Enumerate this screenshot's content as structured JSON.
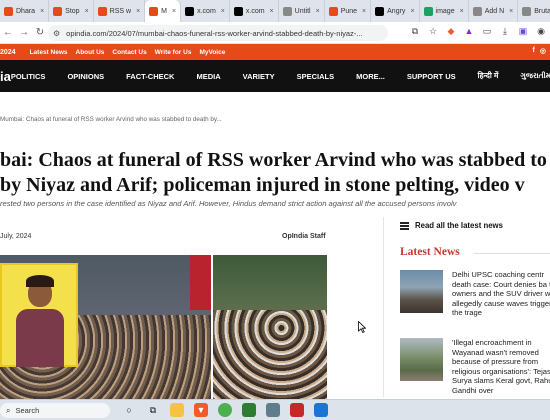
{
  "browser": {
    "tabs": [
      {
        "label": "Dhara",
        "color": "#e64a19",
        "active": false
      },
      {
        "label": "Stop",
        "color": "#e64a19",
        "active": false
      },
      {
        "label": "RSS w",
        "color": "#e64a19",
        "active": false
      },
      {
        "label": "M",
        "color": "#e64a19",
        "active": true
      },
      {
        "label": "x.com",
        "color": "#000000",
        "active": false
      },
      {
        "label": "x.com",
        "color": "#000000",
        "active": false
      },
      {
        "label": "Untitl",
        "color": "#888888",
        "active": false
      },
      {
        "label": "Pune",
        "color": "#e64a19",
        "active": false
      },
      {
        "label": "Angry",
        "color": "#000000",
        "active": false
      },
      {
        "label": "image",
        "color": "#1aa260",
        "active": false
      },
      {
        "label": "Add N",
        "color": "#888888",
        "active": false
      },
      {
        "label": "Brutal",
        "color": "#888888",
        "active": false
      }
    ],
    "close_glyph": "×",
    "new_tab": "+",
    "url": "opindia.com/2024/07/mumbai-chaos-funeral-rss-worker-arvind-stabbed-death-by-niyaz-..."
  },
  "site": {
    "topbar_year": "2024",
    "topbar_links": [
      "Latest News",
      "About Us",
      "Contact Us",
      "Write for Us",
      "MyVoice"
    ],
    "logo_fragment": "ia",
    "menu": [
      "POLITICS",
      "OPINIONS",
      "FACT-CHECK",
      "MEDIA",
      "VARIETY",
      "SPECIALS",
      "MORE...",
      "SUPPORT US",
      "हिन्दी में",
      "ગુજરાતીમાં"
    ],
    "accent": "#e64a19"
  },
  "article": {
    "breadcrumb": "Mumbai: Chaos at funeral of RSS worker Arvind who was stabbed to death by...",
    "headline_line1": "bai: Chaos at funeral of RSS worker Arvind who was stabbed to",
    "headline_line2": "by Niyaz and Arif; policeman injured in stone pelting, video v",
    "subtitle": "rested two persons in the case identified as Niyaz and Arif. However, Hindus demand strict action against all the accused persons involv",
    "date": "July, 2024",
    "author": "OpIndia Staff"
  },
  "sidebar": {
    "read_all": "Read all the latest news",
    "latest_title": "Latest News",
    "items": [
      {
        "text": "Delhi UPSC coaching centr death case: Court denies ba to 4 owners and the SUV driver who allegedly cause waves triggering the trage"
      },
      {
        "text": "'Illegal encroachment in Wayanad wasn't removed because of pressure from religious organisations': Tejasvi Surya slams Keral govt, Rahul Gandhi over"
      }
    ]
  },
  "share_colors": [
    "#3b5998",
    "#1da1f2",
    "#25d366",
    "#0077b5",
    "#e60023",
    "#ff4500",
    "#f57c00"
  ],
  "taskbar": {
    "search_placeholder": "Search"
  }
}
